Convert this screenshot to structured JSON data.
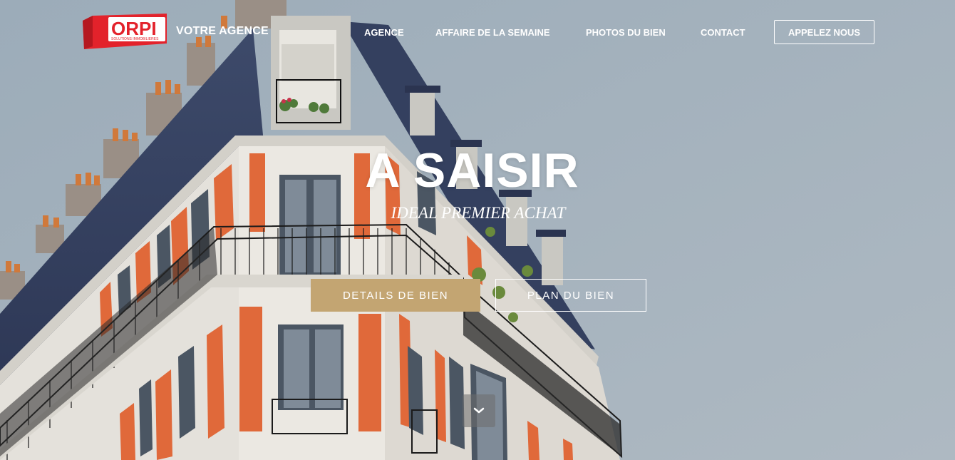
{
  "brand": {
    "logo_text": "ORPI",
    "logo_tagline": "SOLUTIONS IMMOBILIERES",
    "title": "VOTRE AGENCE"
  },
  "nav": {
    "items": [
      {
        "label": "AGENCE"
      },
      {
        "label": "AFFAIRE DE LA SEMAINE"
      },
      {
        "label": "PHOTOS DU BIEN"
      },
      {
        "label": "CONTACT"
      }
    ],
    "call_label": "APPELEZ NOUS"
  },
  "hero": {
    "headline": "A SAISIR",
    "subheadline": "IDEAL PREMIER ACHAT",
    "primary_button": "DETAILS DE BIEN",
    "secondary_button": "PLAN DU BIEN",
    "scroll_icon": "chevron-down-icon"
  },
  "colors": {
    "brand_red": "#e3222b",
    "accent_gold": "#c3a572",
    "sky": "#a7b6c1"
  }
}
